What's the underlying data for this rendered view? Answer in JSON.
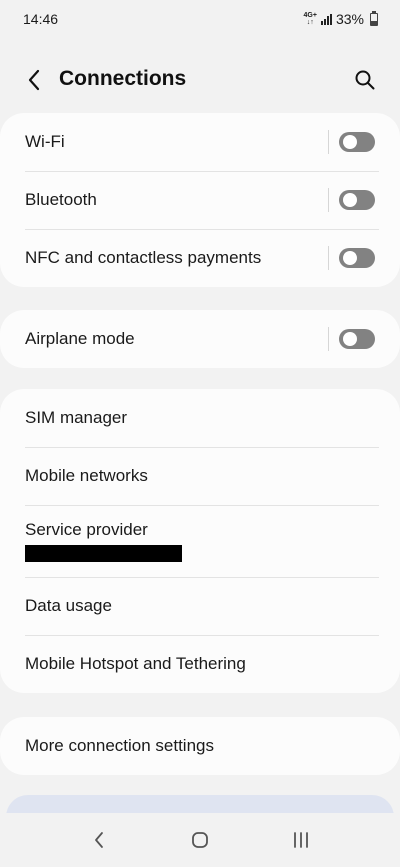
{
  "status_bar": {
    "time": "14:46",
    "network_type": "4G+",
    "battery": "33%"
  },
  "header": {
    "title": "Connections",
    "back_icon": "chevron-left-icon",
    "search_icon": "search-icon"
  },
  "groups": [
    {
      "items": [
        {
          "label": "Wi-Fi",
          "toggle": "off"
        },
        {
          "label": "Bluetooth",
          "toggle": "off"
        },
        {
          "label": "NFC and contactless payments",
          "toggle": "off"
        }
      ]
    },
    {
      "items": [
        {
          "label": "Airplane mode",
          "toggle": "off"
        }
      ]
    },
    {
      "items": [
        {
          "label": "SIM manager"
        },
        {
          "label": "Mobile networks"
        },
        {
          "label": "Service provider",
          "subtitle": "redacted"
        },
        {
          "label": "Data usage"
        },
        {
          "label": "Mobile Hotspot and Tethering"
        }
      ]
    },
    {
      "items": [
        {
          "label": "More connection settings"
        }
      ]
    }
  ],
  "colors": {
    "background": "#f2f2f2",
    "card": "#fcfcfc",
    "toggle_off": "#828282",
    "bottom_card": "#dfe4f1"
  },
  "nav_bar": {
    "back_icon": "nav-back-icon",
    "home_icon": "nav-home-icon",
    "recents_icon": "nav-recents-icon"
  }
}
